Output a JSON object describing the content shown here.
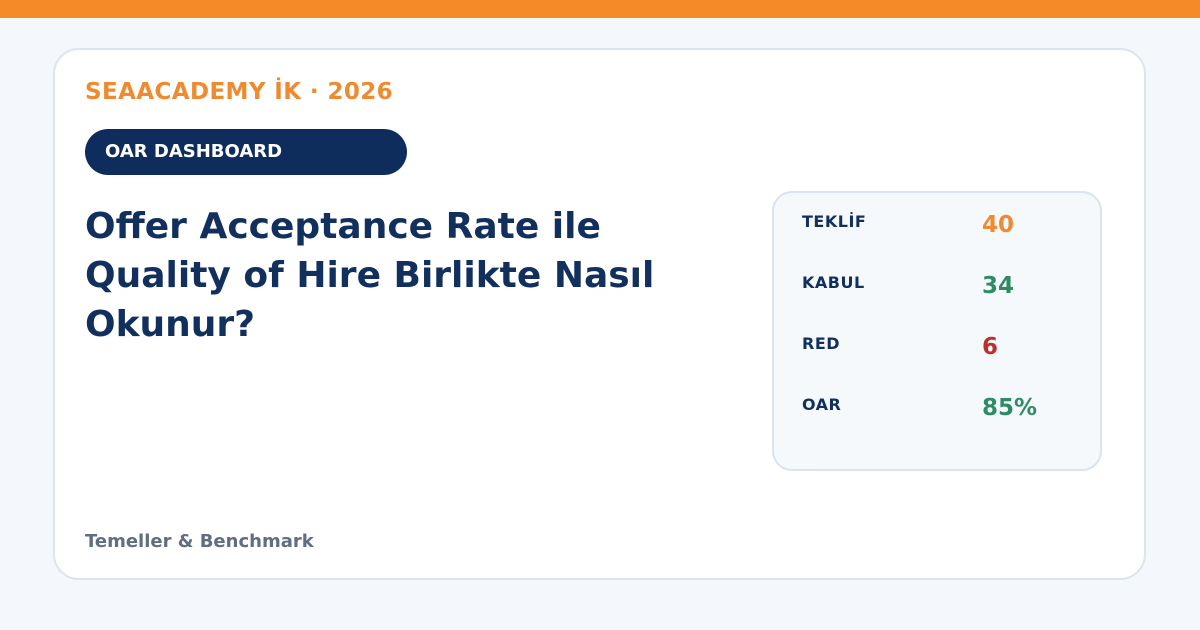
{
  "brand": {
    "eyebrow": "SEAACADEMY İK · 2026",
    "accent_color": "#f58a29",
    "navy_color": "#0f2d5c"
  },
  "badge": {
    "label": "OAR DASHBOARD"
  },
  "headline": {
    "text": "Offer Acceptance Rate ile Quality of Hire Birlikte Nasıl Okunur?"
  },
  "stats": [
    {
      "label": "TEKLİF",
      "value": "40",
      "color": "#ee8a2f"
    },
    {
      "label": "KABUL",
      "value": "34",
      "color": "#2e8b63"
    },
    {
      "label": "RED",
      "value": "6",
      "color": "#b7322c"
    },
    {
      "label": "OAR",
      "value": "85%",
      "color": "#2e8b63"
    }
  ],
  "footer": {
    "text": "Temeller & Benchmark"
  }
}
